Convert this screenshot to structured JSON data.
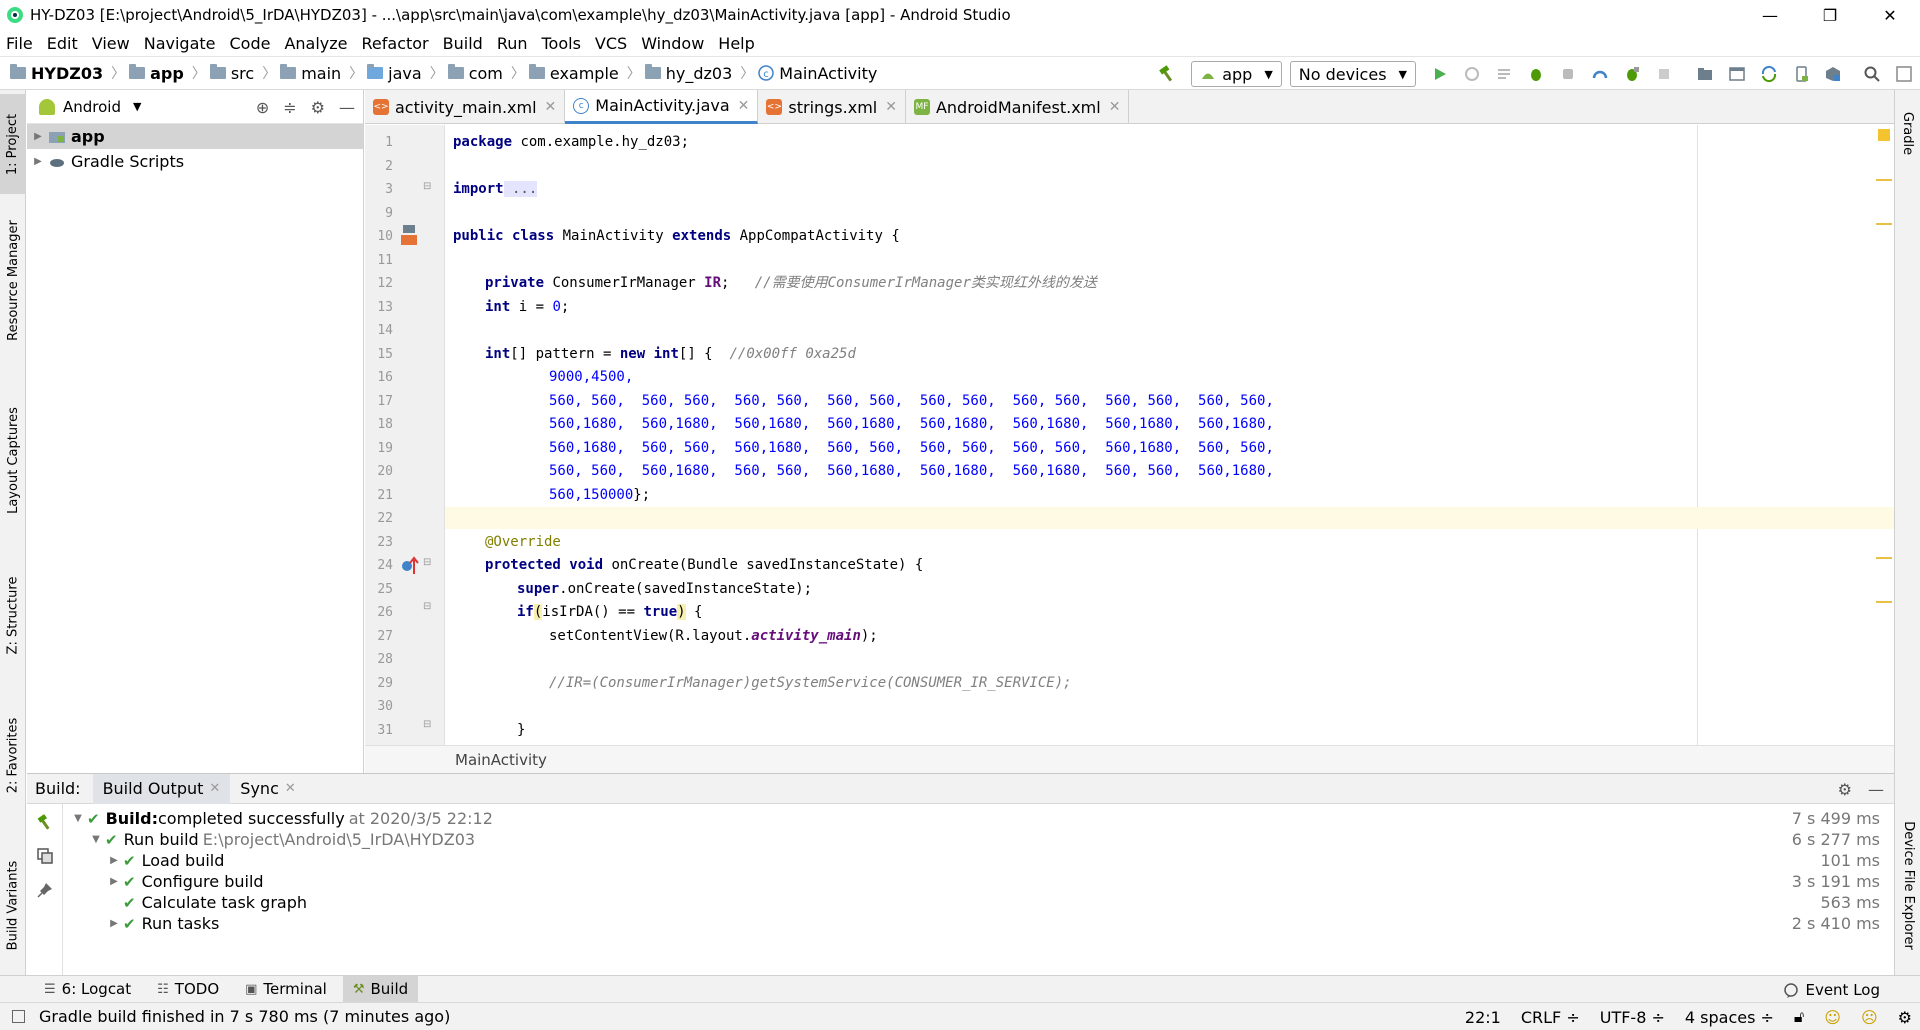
{
  "window": {
    "title": "HY-DZ03 [E:\\project\\Android\\5_IrDA\\HYDZ03] - ...\\app\\src\\main\\java\\com\\example\\hy_dz03\\MainActivity.java [app] - Android Studio",
    "minimize": "—",
    "maximize": "❐",
    "close": "✕"
  },
  "menu": [
    "File",
    "Edit",
    "View",
    "Navigate",
    "Code",
    "Analyze",
    "Refactor",
    "Build",
    "Run",
    "Tools",
    "VCS",
    "Window",
    "Help"
  ],
  "breadcrumb": [
    "HYDZ03",
    "app",
    "src",
    "main",
    "java",
    "com",
    "example",
    "hy_dz03",
    "MainActivity"
  ],
  "toolbar": {
    "run_config": "app",
    "device": "No devices"
  },
  "left_tools": [
    "1: Project",
    "Resource Manager",
    "Layout Captures",
    "Z: Structure",
    "2: Favorites",
    "Build Variants"
  ],
  "right_tools": [
    "Gradle",
    "Device File Explorer"
  ],
  "project_panel": {
    "view": "Android",
    "items": [
      {
        "label": "app",
        "selected": true
      },
      {
        "label": "Gradle Scripts",
        "selected": false
      }
    ]
  },
  "editor_tabs": [
    {
      "label": "activity_main.xml",
      "active": false
    },
    {
      "label": "MainActivity.java",
      "active": true
    },
    {
      "label": "strings.xml",
      "active": false
    },
    {
      "label": "AndroidManifest.xml",
      "active": false
    }
  ],
  "editor": {
    "line_numbers": [
      "1",
      "2",
      "3",
      "9",
      "10",
      "11",
      "12",
      "13",
      "14",
      "15",
      "16",
      "17",
      "18",
      "19",
      "20",
      "21",
      "22",
      "23",
      "24",
      "25",
      "26",
      "27",
      "28",
      "29",
      "30",
      "31"
    ],
    "code": {
      "l1_kw": "package",
      "l1_rest": " com.example.hy_dz03;",
      "l3_kw": "import",
      "l3_fold": " ...",
      "l10_kw1": "public class",
      "l10_mid": " MainActivity ",
      "l10_kw2": "extends",
      "l10_rest": " AppCompatActivity {",
      "l12_kw": "private",
      "l12_type": " ConsumerIrManager ",
      "l12_field": "IR",
      "l12_semi": ";   ",
      "l12_comment": "//需要使用ConsumerIrManager类实现红外线的发送",
      "l13_kw": "int",
      "l13_mid": " i = ",
      "l13_num": "0",
      "l13_end": ";",
      "l15_kw1": "int",
      "l15_a": "[] pattern = ",
      "l15_kw2": "new int",
      "l15_b": "[] {  ",
      "l15_comment": "//0x00ff 0xa25d",
      "l16": "9000,4500,",
      "l17": "560, 560,  560, 560,  560, 560,  560, 560,  560, 560,  560, 560,  560, 560,  560, 560,",
      "l18": "560,1680,  560,1680,  560,1680,  560,1680,  560,1680,  560,1680,  560,1680,  560,1680,",
      "l19": "560,1680,  560, 560,  560,1680,  560, 560,  560, 560,  560, 560,  560,1680,  560, 560,",
      "l20": "560, 560,  560,1680,  560, 560,  560,1680,  560,1680,  560,1680,  560, 560,  560,1680,",
      "l21_num": "560,150000",
      "l21_end": "};",
      "l23_ann": "@Override",
      "l24_kw": "protected void",
      "l24_rest": " onCreate(Bundle savedInstanceState) {",
      "l25_kw": "super",
      "l25_rest": ".onCreate(savedInstanceState);",
      "l26_kw": "if",
      "l26_paren": "(",
      "l26_mid": "isIrDA() == ",
      "l26_kw2": "true",
      "l26_paren2": ")",
      "l26_end": " {",
      "l27_a": "setContentView(R.layout.",
      "l27_field": "activity_main",
      "l27_end": ");",
      "l29_comment": "//IR=(ConsumerIrManager)getSystemService(CONSUMER_IR_SERVICE);",
      "l31": "}"
    },
    "bottom_breadcrumb": "MainActivity"
  },
  "build_panel": {
    "label": "Build:",
    "tabs": [
      {
        "label": "Build Output",
        "active": true
      },
      {
        "label": "Sync",
        "active": false
      }
    ],
    "rows": [
      {
        "bold": "Build:",
        "text": " completed successfully",
        "muted": "at 2020/3/5 22:12",
        "duration": "7 s 499 ms"
      },
      {
        "bold": "",
        "text": "Run build",
        "muted": "E:\\project\\Android\\5_IrDA\\HYDZ03",
        "duration": "6 s 277 ms"
      },
      {
        "bold": "",
        "text": "Load build",
        "muted": "",
        "duration": "101 ms"
      },
      {
        "bold": "",
        "text": "Configure build",
        "muted": "",
        "duration": "3 s 191 ms"
      },
      {
        "bold": "",
        "text": "Calculate task graph",
        "muted": "",
        "duration": "563 ms"
      },
      {
        "bold": "",
        "text": "Run tasks",
        "muted": "",
        "duration": "2 s 410 ms"
      }
    ]
  },
  "bottom_tools": {
    "tabs": [
      {
        "label": "6: Logcat",
        "active": false
      },
      {
        "label": "TODO",
        "active": false
      },
      {
        "label": "Terminal",
        "active": false
      },
      {
        "label": "Build",
        "active": true
      }
    ],
    "event_log": "Event Log"
  },
  "status": {
    "message": "Gradle build finished in 7 s 780 ms (7 minutes ago)",
    "position": "22:1",
    "line_sep": "CRLF ÷",
    "encoding": "UTF-8 ÷",
    "indent": "4 spaces ÷"
  },
  "colors": {
    "accent": "#4083c9",
    "success": "#3c9c3c",
    "keyword": "#000080",
    "number": "#0000ff"
  }
}
